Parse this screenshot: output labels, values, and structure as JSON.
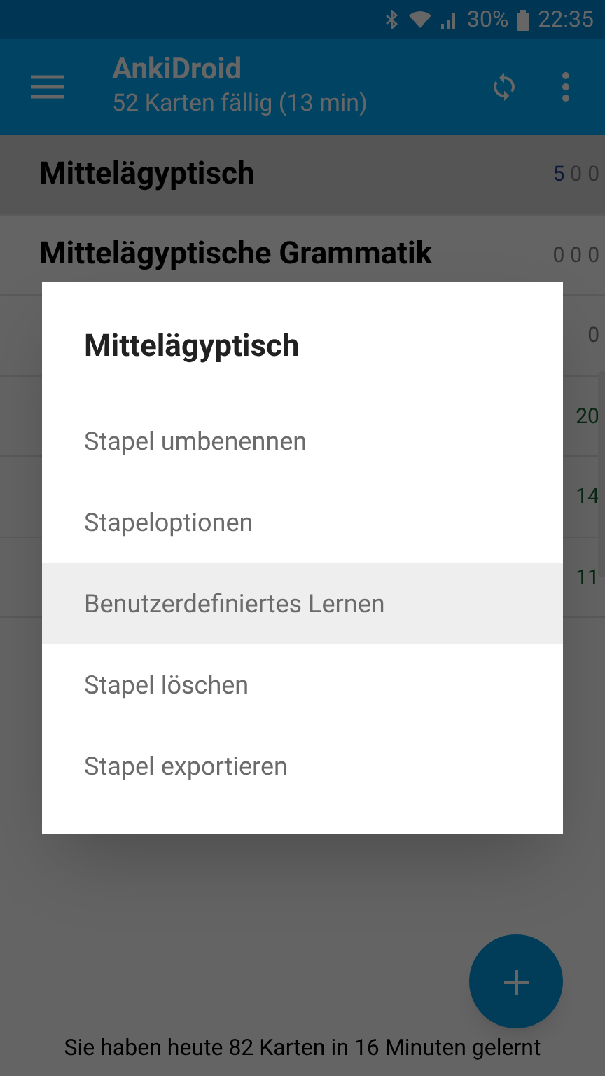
{
  "status_bar": {
    "battery": "30%",
    "time": "22:35"
  },
  "app_bar": {
    "title": "AnkiDroid",
    "subtitle": "52 Karten fällig (13 min)"
  },
  "decks": [
    {
      "name": "Mittelägyptisch",
      "selected": true,
      "counts": [
        {
          "text": "5",
          "kind": "new"
        },
        {
          "text": "0",
          "kind": "zero"
        },
        {
          "text": "0",
          "kind": "zero"
        }
      ]
    },
    {
      "name": "Mittelägyptische Grammatik",
      "selected": false,
      "counts": [
        {
          "text": "0",
          "kind": "zero"
        },
        {
          "text": "0",
          "kind": "zero"
        },
        {
          "text": "0",
          "kind": "zero"
        }
      ]
    },
    {
      "selected": false,
      "counts": [
        {
          "text": "0",
          "kind": "zero"
        }
      ]
    },
    {
      "selected": false,
      "counts": [
        {
          "text": "20",
          "kind": "review"
        }
      ]
    },
    {
      "selected": false,
      "counts": [
        {
          "text": "14",
          "kind": "review"
        }
      ]
    },
    {
      "selected": false,
      "counts": [
        {
          "text": "11",
          "kind": "review"
        }
      ]
    }
  ],
  "summary": "Sie haben heute 82 Karten in 16 Minuten gelernt",
  "dialog": {
    "title": "Mittelägyptisch",
    "items": [
      {
        "label": "Stapel umbenennen",
        "selected": false
      },
      {
        "label": "Stapeloptionen",
        "selected": false
      },
      {
        "label": "Benutzerdefiniertes Lernen",
        "selected": true
      },
      {
        "label": "Stapel löschen",
        "selected": false
      },
      {
        "label": "Stapel exportieren",
        "selected": false
      }
    ]
  }
}
